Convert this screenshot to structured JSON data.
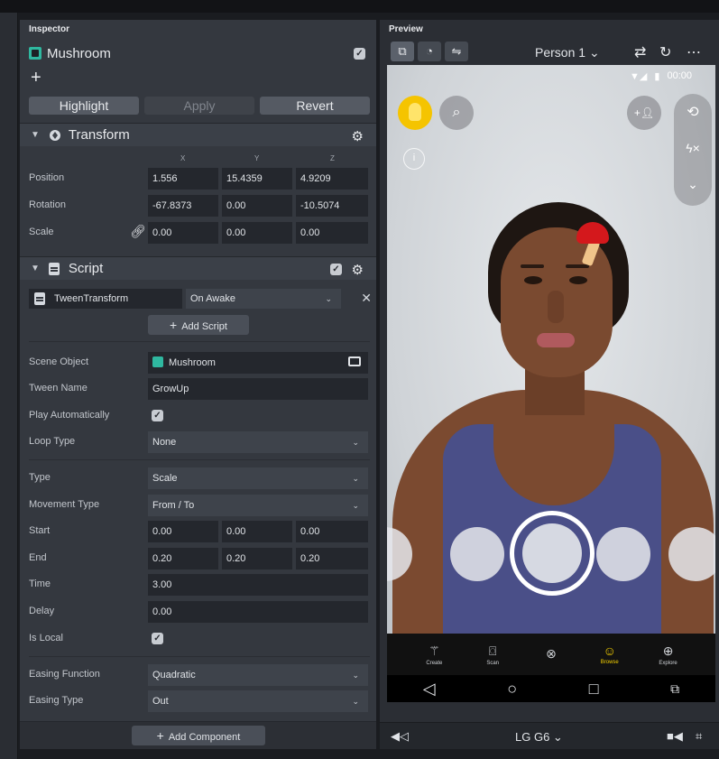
{
  "inspector": {
    "title": "Inspector",
    "object_name": "Mushroom",
    "buttons": {
      "highlight": "Highlight",
      "apply": "Apply",
      "revert": "Revert"
    },
    "transform": {
      "title": "Transform",
      "axes": [
        "X",
        "Y",
        "Z"
      ],
      "rows": [
        {
          "label": "Position",
          "values": [
            "1.556",
            "15.4359",
            "4.9209"
          ]
        },
        {
          "label": "Rotation",
          "values": [
            "-67.8373",
            "0.00",
            "-10.5074"
          ]
        },
        {
          "label": "Scale",
          "values": [
            "0.00",
            "0.00",
            "0.00"
          ]
        }
      ]
    },
    "script": {
      "title": "Script",
      "script_name": "TweenTransform",
      "trigger": "On Awake",
      "add_script": "Add Script"
    },
    "fields": {
      "scene_object": {
        "label": "Scene Object",
        "value": "Mushroom"
      },
      "tween_name": {
        "label": "Tween Name",
        "value": "GrowUp"
      },
      "play_auto": {
        "label": "Play Automatically"
      },
      "loop_type": {
        "label": "Loop Type",
        "value": "None"
      },
      "type": {
        "label": "Type",
        "value": "Scale"
      },
      "movement_type": {
        "label": "Movement Type",
        "value": "From / To"
      },
      "start": {
        "label": "Start",
        "values": [
          "0.00",
          "0.00",
          "0.00"
        ]
      },
      "end": {
        "label": "End",
        "values": [
          "0.20",
          "0.20",
          "0.20"
        ]
      },
      "time": {
        "label": "Time",
        "value": "3.00"
      },
      "delay": {
        "label": "Delay",
        "value": "0.00"
      },
      "is_local": {
        "label": "Is Local"
      },
      "easing_function": {
        "label": "Easing Function",
        "value": "Quadratic"
      },
      "easing_type": {
        "label": "Easing Type",
        "value": "Out"
      }
    },
    "add_component": "Add Component"
  },
  "preview": {
    "title": "Preview",
    "person_select": "Person 1",
    "status_time": "00:00",
    "nav": [
      "Create",
      "Scan",
      "",
      "Browse",
      "Explore"
    ],
    "device": "LG G6"
  }
}
